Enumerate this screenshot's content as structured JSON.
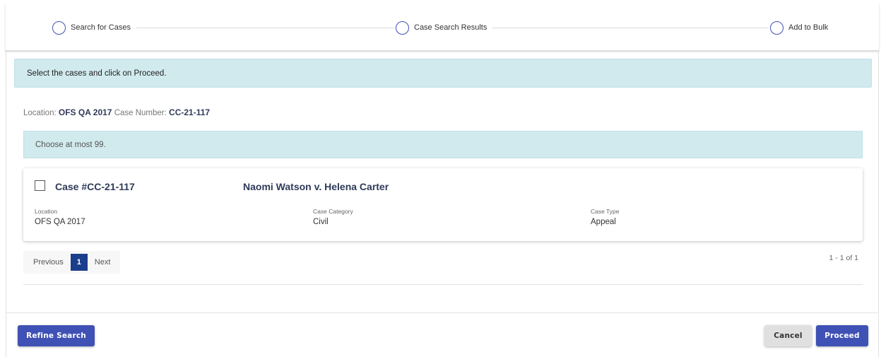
{
  "stepper": {
    "steps": [
      {
        "label": "Search for Cases"
      },
      {
        "label": "Case Search Results"
      },
      {
        "label": "Add to Bulk"
      }
    ]
  },
  "banner": {
    "instruction": "Select the cases and click on Proceed.",
    "limit": "Choose at most 99."
  },
  "search_summary": {
    "location_label": "Location:",
    "location_value": "OFS QA 2017",
    "case_number_label": "Case Number:",
    "case_number_value": "CC-21-117"
  },
  "case": {
    "number": "Case #CC-21-117",
    "title": "Naomi Watson v. Helena Carter",
    "fields": [
      {
        "label": "Location",
        "value": "OFS QA 2017"
      },
      {
        "label": "Case Category",
        "value": "Civil"
      },
      {
        "label": "Case Type",
        "value": "Appeal"
      }
    ]
  },
  "pagination": {
    "previous_label": "Previous",
    "current_page": "1",
    "next_label": "Next",
    "range": "1 - 1 of 1"
  },
  "footer": {
    "refine_label": "Refine Search",
    "cancel_label": "Cancel",
    "proceed_label": "Proceed"
  },
  "colors": {
    "primary": "#3f51b5",
    "info_bg": "#d1eaee",
    "page_active": "#1a3e8c"
  }
}
